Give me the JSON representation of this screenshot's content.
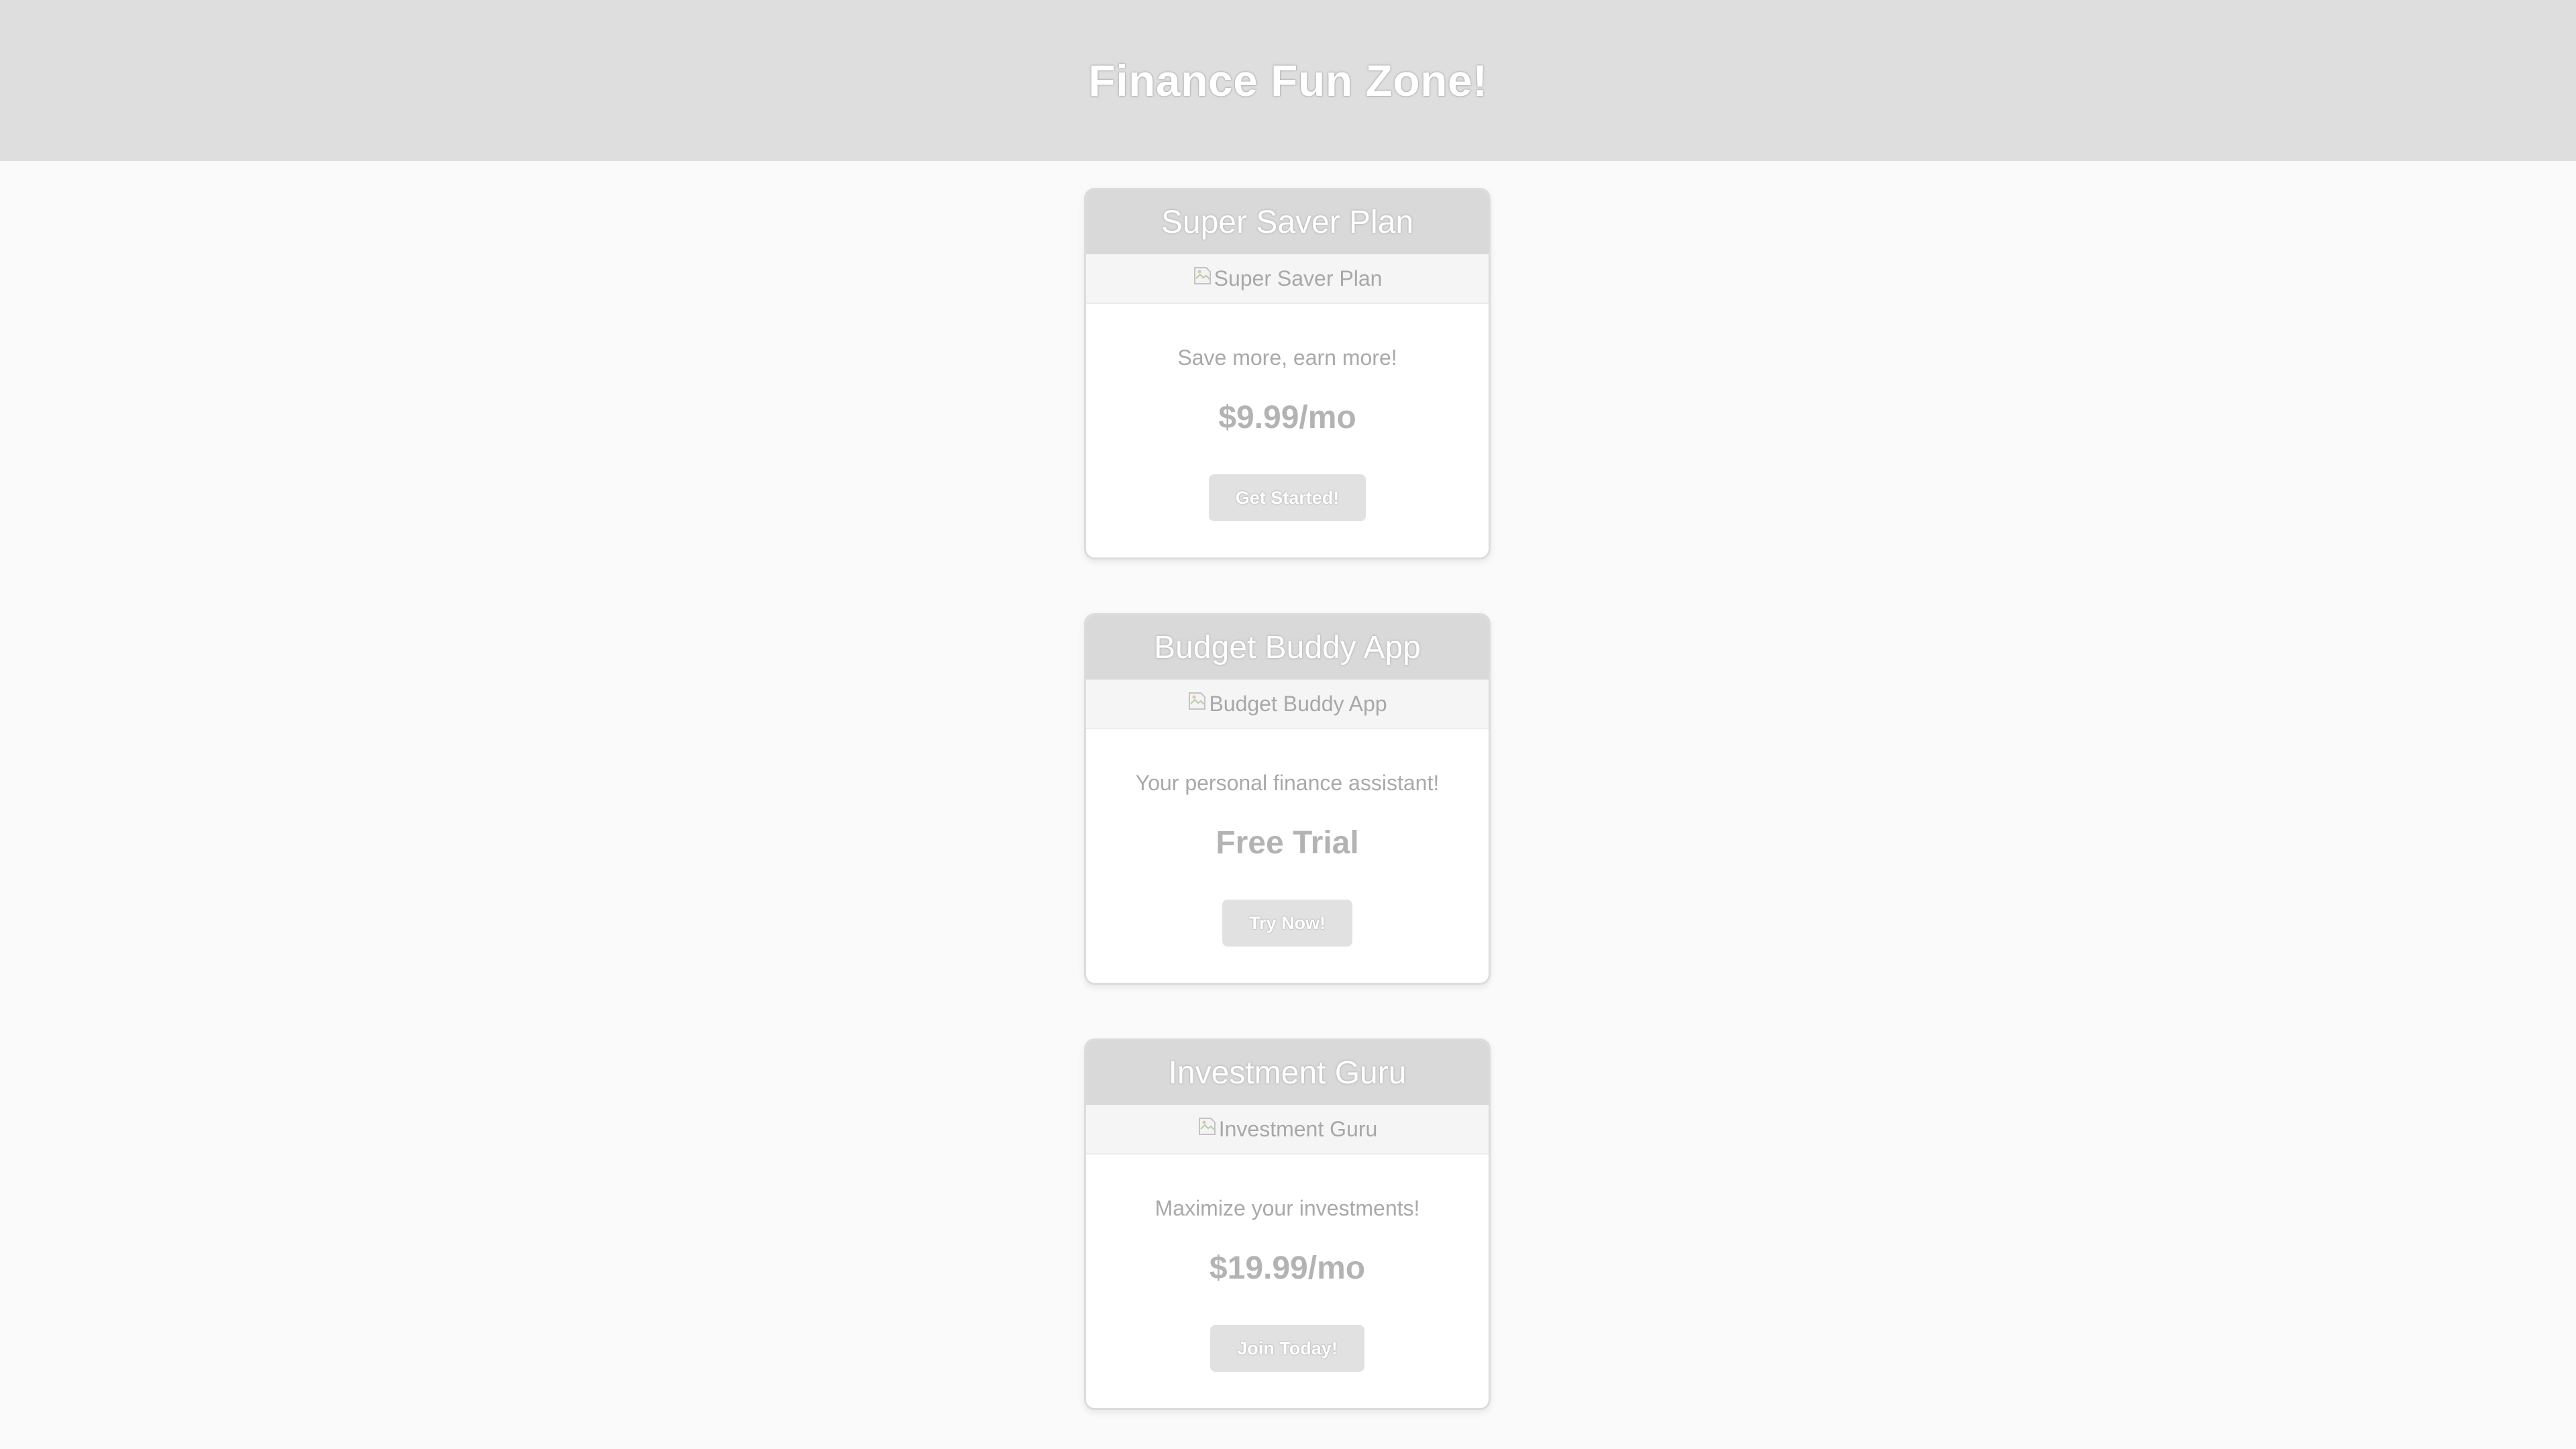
{
  "header": {
    "title": "Finance Fun Zone!"
  },
  "cards": [
    {
      "title": "Super Saver Plan",
      "image_alt": "Super Saver Plan",
      "description": "Save more, earn more!",
      "price": "$9.99/mo",
      "button_label": "Get Started!"
    },
    {
      "title": "Budget Buddy App",
      "image_alt": "Budget Buddy App",
      "description": "Your personal finance assistant!",
      "price": "Free Trial",
      "button_label": "Try Now!"
    },
    {
      "title": "Investment Guru",
      "image_alt": "Investment Guru",
      "description": "Maximize your investments!",
      "price": "$19.99/mo",
      "button_label": "Join Today!"
    }
  ],
  "icons": {
    "broken_image": "broken-image-icon"
  },
  "colors": {
    "header_bg": "#dedede",
    "page_bg": "#fafafa",
    "card_title_bg": "#d9d9d9",
    "button_bg": "#e1e1e1"
  }
}
